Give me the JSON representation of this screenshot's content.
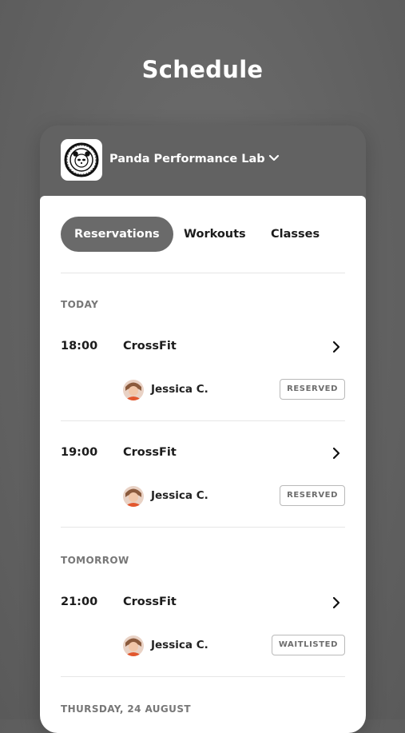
{
  "header": {
    "title": "Schedule"
  },
  "gym": {
    "name": "Panda Performance Lab",
    "logo_icon": "panda-lab-logo-icon"
  },
  "tabs": [
    {
      "label": "Reservations",
      "active": true
    },
    {
      "label": "Workouts",
      "active": false
    },
    {
      "label": "Classes",
      "active": false
    }
  ],
  "sections": [
    {
      "label": "TODAY",
      "items": [
        {
          "time": "18:00",
          "class": "CrossFit",
          "person": "Jessica C.",
          "status": "RESERVED"
        },
        {
          "time": "19:00",
          "class": "CrossFit",
          "person": "Jessica C.",
          "status": "RESERVED"
        }
      ]
    },
    {
      "label": "TOMORROW",
      "items": [
        {
          "time": "21:00",
          "class": "CrossFit",
          "person": "Jessica C.",
          "status": "WAITLISTED"
        }
      ]
    },
    {
      "label": "THURSDAY, 24 AUGUST",
      "items": []
    }
  ],
  "colors": {
    "background": "#626262",
    "accent": "#6a6a6a",
    "panel": "#ffffff"
  }
}
